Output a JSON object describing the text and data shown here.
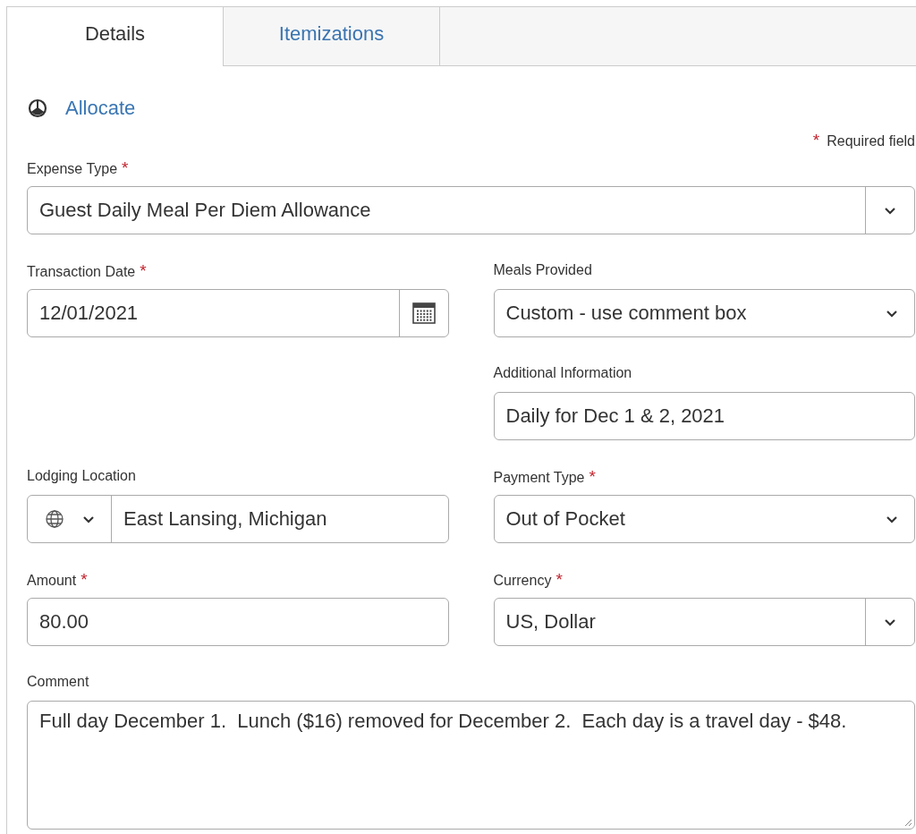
{
  "tabs": [
    {
      "label": "Details",
      "selected": true
    },
    {
      "label": "Itemizations",
      "selected": false
    }
  ],
  "allocate_link": "Allocate",
  "required_note": {
    "mark": "*",
    "text": "Required field"
  },
  "rows": [
    {
      "full": {
        "kind": "select_split",
        "label": "Expense Type",
        "required": true,
        "value": "Guest Daily Meal Per Diem Allowance"
      }
    },
    {
      "left": {
        "kind": "date",
        "label": "Transaction Date",
        "required": true,
        "value": "12/01/2021"
      },
      "right": {
        "kind": "select",
        "label": "Meals Provided",
        "required": false,
        "value": "Custom - use comment box"
      }
    },
    {
      "right": {
        "kind": "text",
        "label": "Additional Information",
        "required": false,
        "value": "Daily for Dec 1 & 2, 2021"
      }
    },
    {
      "left": {
        "kind": "location",
        "label": "Lodging Location",
        "required": false,
        "value": "East Lansing, Michigan"
      },
      "right": {
        "kind": "select",
        "label": "Payment Type",
        "required": true,
        "value": "Out of Pocket"
      }
    },
    {
      "left": {
        "kind": "text",
        "label": "Amount",
        "required": true,
        "value": "80.00"
      },
      "right": {
        "kind": "select_split",
        "label": "Currency",
        "required": true,
        "value": "US, Dollar"
      }
    },
    {
      "full": {
        "kind": "textarea",
        "label": "Comment",
        "required": false,
        "value": "Full day December 1.  Lunch ($16) removed for December 2.  Each day is a travel day - $48."
      }
    }
  ]
}
